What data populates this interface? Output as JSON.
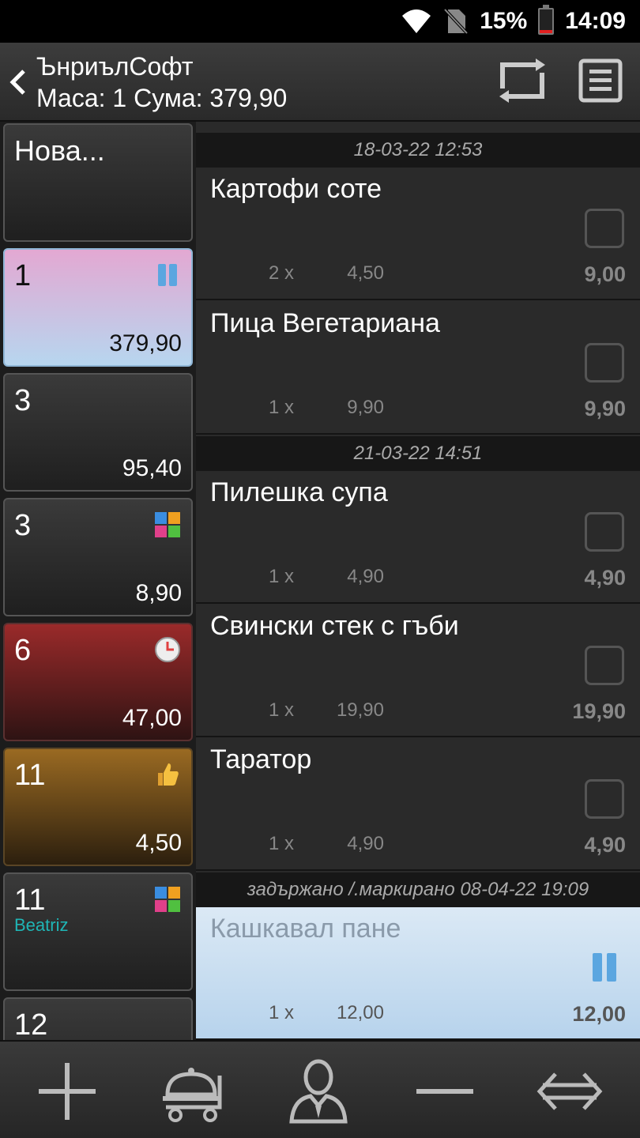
{
  "status_bar": {
    "battery": "15%",
    "time": "14:09"
  },
  "header": {
    "title": "ЪнриълСофт",
    "subtitle": "Маса: 1 Сума: 379,90"
  },
  "tables": [
    {
      "num": "Нова...",
      "amount": "",
      "waiter": ""
    },
    {
      "num": "1",
      "amount": "379,90",
      "waiter": ""
    },
    {
      "num": "3",
      "amount": "95,40",
      "waiter": ""
    },
    {
      "num": "3",
      "amount": "8,90",
      "waiter": ""
    },
    {
      "num": "6",
      "amount": "47,00",
      "waiter": ""
    },
    {
      "num": "11",
      "amount": "4,50",
      "waiter": ""
    },
    {
      "num": "11",
      "amount": "",
      "waiter": "Beatriz"
    },
    {
      "num": "12",
      "amount": "",
      "waiter": ""
    }
  ],
  "orders": {
    "groups": [
      "18-03-22 12:53",
      "21-03-22 14:51",
      "задържано /.маркирано 08-04-22 19:09"
    ],
    "items": [
      {
        "name": "Картофи соте",
        "qty": "2 x",
        "price": "4,50",
        "total": "9,00"
      },
      {
        "name": "Пица Вегетариана",
        "qty": "1 x",
        "price": "9,90",
        "total": "9,90"
      },
      {
        "name": "Пилешка супа",
        "qty": "1 x",
        "price": "4,90",
        "total": "4,90"
      },
      {
        "name": "Свински стек с гъби",
        "qty": "1 x",
        "price": "19,90",
        "total": "19,90"
      },
      {
        "name": "Таратор",
        "qty": "1 x",
        "price": "4,90",
        "total": "4,90"
      },
      {
        "name": "Кашкавал пане",
        "qty": "1 x",
        "price": "12,00",
        "total": "12,00"
      }
    ]
  },
  "icons": {
    "tables": [
      "",
      "pause-icon",
      "",
      "service-grid-icon",
      "clock-icon",
      "thumbs-up-icon",
      "service-grid-icon",
      ""
    ],
    "toolbar": [
      "plus-icon",
      "serving-cart-icon",
      "waiter-icon",
      "minus-icon",
      "transfer-arrows-icon"
    ]
  },
  "colors": {
    "selected_tile": "#e3a8d2",
    "red_tile": "#9a2a2a",
    "brown_tile": "#9a6a22",
    "waiter_name": "#1fb5b5",
    "held_item": "#dbe9f5",
    "pause_blue": "#5ba6e0"
  }
}
